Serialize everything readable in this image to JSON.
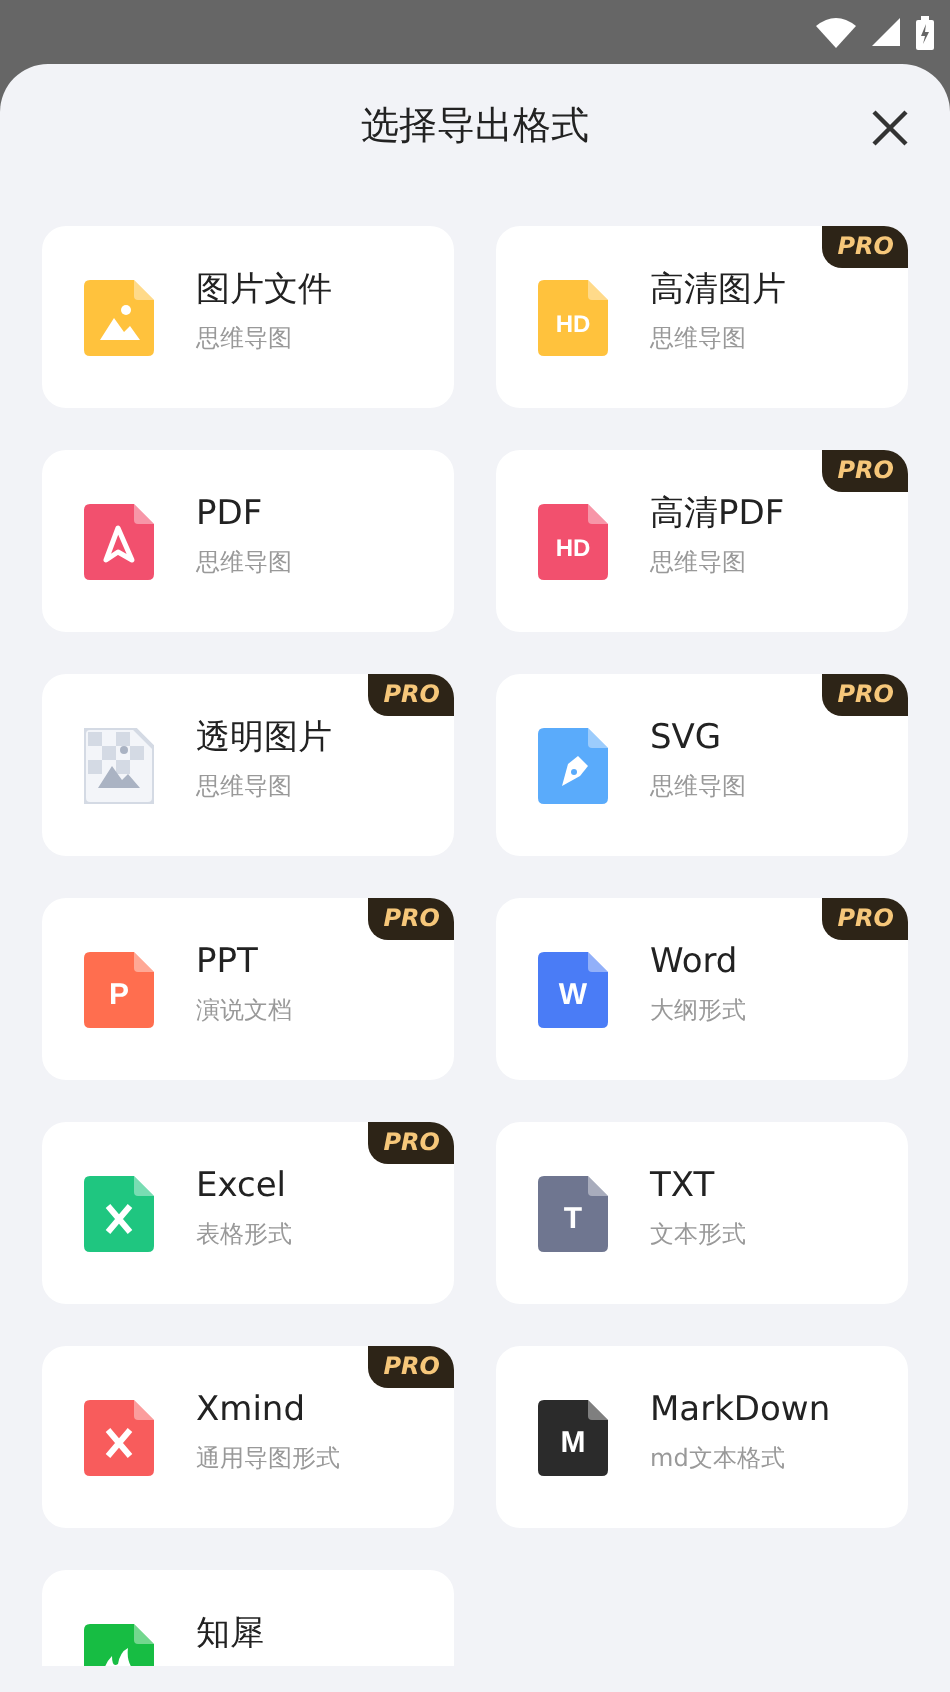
{
  "title": "选择导出格式",
  "formats": [
    {
      "title": "图片文件",
      "subtitle": "思维导图",
      "kind": "image",
      "color": "#ffc23d"
    },
    {
      "title": "高清图片",
      "subtitle": "思维导图",
      "badge": "PRO",
      "kind": "letter",
      "glyph": "HD",
      "color": "#ffc23d"
    },
    {
      "title": "PDF",
      "subtitle": "思维导图",
      "kind": "pdf",
      "color": "#f2506e"
    },
    {
      "title": "高清PDF",
      "subtitle": "思维导图",
      "badge": "PRO",
      "kind": "letter",
      "glyph": "HD",
      "color": "#f2506e"
    },
    {
      "title": "透明图片",
      "subtitle": "思维导图",
      "badge": "PRO",
      "kind": "transparent",
      "color": "#d4dae4"
    },
    {
      "title": "SVG",
      "subtitle": "思维导图",
      "badge": "PRO",
      "kind": "pen",
      "color": "#5aabfb"
    },
    {
      "title": "PPT",
      "subtitle": "演说文档",
      "badge": "PRO",
      "kind": "letter",
      "glyph": "P",
      "color": "#ff6e4f"
    },
    {
      "title": "Word",
      "subtitle": "大纲形式",
      "badge": "PRO",
      "kind": "letter",
      "glyph": "W",
      "color": "#4a7cf6"
    },
    {
      "title": "Excel",
      "subtitle": "表格形式",
      "badge": "PRO",
      "kind": "cross",
      "color": "#1fc680"
    },
    {
      "title": "TXT",
      "subtitle": "文本形式",
      "kind": "letter",
      "glyph": "T",
      "color": "#6f7690"
    },
    {
      "title": "Xmind",
      "subtitle": "通用导图形式",
      "badge": "PRO",
      "kind": "cross",
      "color": "#f85c5c"
    },
    {
      "title": "MarkDown",
      "subtitle": "md文本格式",
      "kind": "letter",
      "glyph": "M",
      "color": "#2b2b2b"
    },
    {
      "title": "知犀",
      "kind": "flame",
      "color": "#17bd43"
    }
  ]
}
